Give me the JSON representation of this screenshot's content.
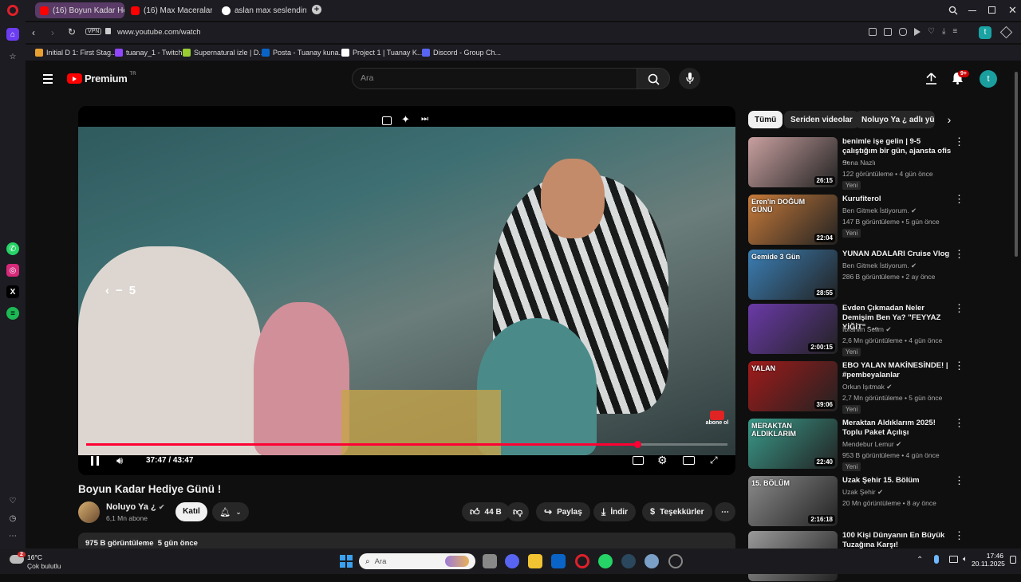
{
  "browser": {
    "tabs": [
      {
        "label": "(16) Boyun Kadar Hed",
        "icon": "youtube-icon",
        "active": true
      },
      {
        "label": "(16) Max Maceraları: Atla",
        "icon": "youtube-icon",
        "active": false
      },
      {
        "label": "aslan max seslendirme - G",
        "icon": "google-icon",
        "active": false
      }
    ],
    "vpn_label": "VPN",
    "url": "www.youtube.com/watch",
    "profile_letter": "t",
    "bookmarks": [
      {
        "label": "Initial D 1: First Stag...",
        "icon": "bookmark-icon"
      },
      {
        "label": "tuanay_1 - Twitch",
        "icon": "twitch-icon"
      },
      {
        "label": "Supernatural izle | D...",
        "icon": "bookmark-icon"
      },
      {
        "label": "Posta - Tuanay kuna...",
        "icon": "outlook-icon"
      },
      {
        "label": "Project 1 | Tuanay K...",
        "icon": "project-icon"
      },
      {
        "label": "Discord - Group Ch...",
        "icon": "discord-icon"
      }
    ]
  },
  "youtube": {
    "logo_text": "Premium",
    "logo_superscript": "TR",
    "search_placeholder": "Ara",
    "notifications_count": "9+",
    "avatar_letter": "t",
    "chips": [
      "Tümü",
      "Seriden videolar",
      "Noluyo Ya ¿ adlı yükle"
    ],
    "player": {
      "seek_label": "5",
      "current_time": "37:47",
      "duration": "43:47",
      "time_display": "37:47 / 43:47",
      "progress_fraction": 0.86,
      "watermark": "abone ol"
    },
    "video": {
      "title": "Boyun Kadar Hediye Günü !",
      "channel": "Noluyo Ya ¿",
      "subscribers": "6,1 Mn abone",
      "join_label": "Katıl",
      "likes": "44 B",
      "share_label": "Paylaş",
      "download_label": "İndir",
      "thanks_label": "Teşekkürler",
      "views_date": "975 B görüntüleme  5 gün önce"
    },
    "recommendations": [
      {
        "title": "benimle işe gelin | 9-5 çalıştığım bir gün, ajansta ofis ...",
        "channel": "Sena Nazlı",
        "verified": false,
        "meta": "122 görüntüleme • 4 gün önce",
        "badge": "Yeni",
        "duration": "26:15",
        "thumb_color": "#c9a0a0"
      },
      {
        "title": "Kurufiterol",
        "channel": "Ben Gitmek İstiyorum.",
        "verified": true,
        "meta": "147 B görüntüleme • 5 gün önce",
        "badge": "Yeni",
        "duration": "22:04",
        "thumb_text": "Eren'in DOĞUM GÜNÜ",
        "thumb_color": "#c87b3a"
      },
      {
        "title": "YUNAN ADALARI Cruise Vlog",
        "channel": "Ben Gitmek İstiyorum.",
        "verified": true,
        "meta": "286 B görüntüleme • 2 ay önce",
        "badge": "",
        "duration": "28:55",
        "thumb_text": "Gemide 3 Gün",
        "thumb_color": "#3b7fb5"
      },
      {
        "title": "Evden Çıkmadan Neler Demişim Ben Ya? \"FEYYAZ YİĞİT\" - ...",
        "channel": "İbrahim Selim",
        "verified": true,
        "meta": "2,6 Mn görüntüleme • 4 gün önce",
        "badge": "Yeni",
        "duration": "2:00:15",
        "thumb_color": "#6a3aa8"
      },
      {
        "title": "EBO YALAN MAKİNESİNDE! | #pembeyalanlar",
        "channel": "Orkun Işıtmak",
        "verified": true,
        "meta": "2,7 Mn görüntüleme • 5 gün önce",
        "badge": "Yeni",
        "duration": "39:06",
        "thumb_text": "YALAN",
        "thumb_color": "#a01a1a"
      },
      {
        "title": "Meraktan Aldıklarım 2025! Toplu Paket Açılışı",
        "channel": "Mendebur Lemur",
        "verified": true,
        "meta": "953 B görüntüleme • 4 gün önce",
        "badge": "Yeni",
        "duration": "22:40",
        "thumb_text": "MERAKTAN ALDIKLARIM",
        "thumb_color": "#3a9a8a"
      },
      {
        "title": "Uzak Şehir 15. Bölüm",
        "channel": "Uzak Şehir",
        "verified": true,
        "meta": "20 Mn görüntüleme • 8 ay önce",
        "badge": "",
        "duration": "2:16:18",
        "thumb_text": "15. BÖLÜM",
        "thumb_color": "#8a8a8a"
      },
      {
        "title": "100 Kişi Dünyanın En Büyük Tuzağına Karşı!",
        "channel": "",
        "verified": false,
        "meta": "",
        "badge": "",
        "duration": "",
        "thumb_color": "#9a9a9a"
      }
    ]
  },
  "taskbar": {
    "weather_temp": "16°C",
    "weather_desc": "Çok bulutlu",
    "weather_badge": "2",
    "search_placeholder": "Ara",
    "time": "17:46",
    "date": "20.11.2025"
  }
}
